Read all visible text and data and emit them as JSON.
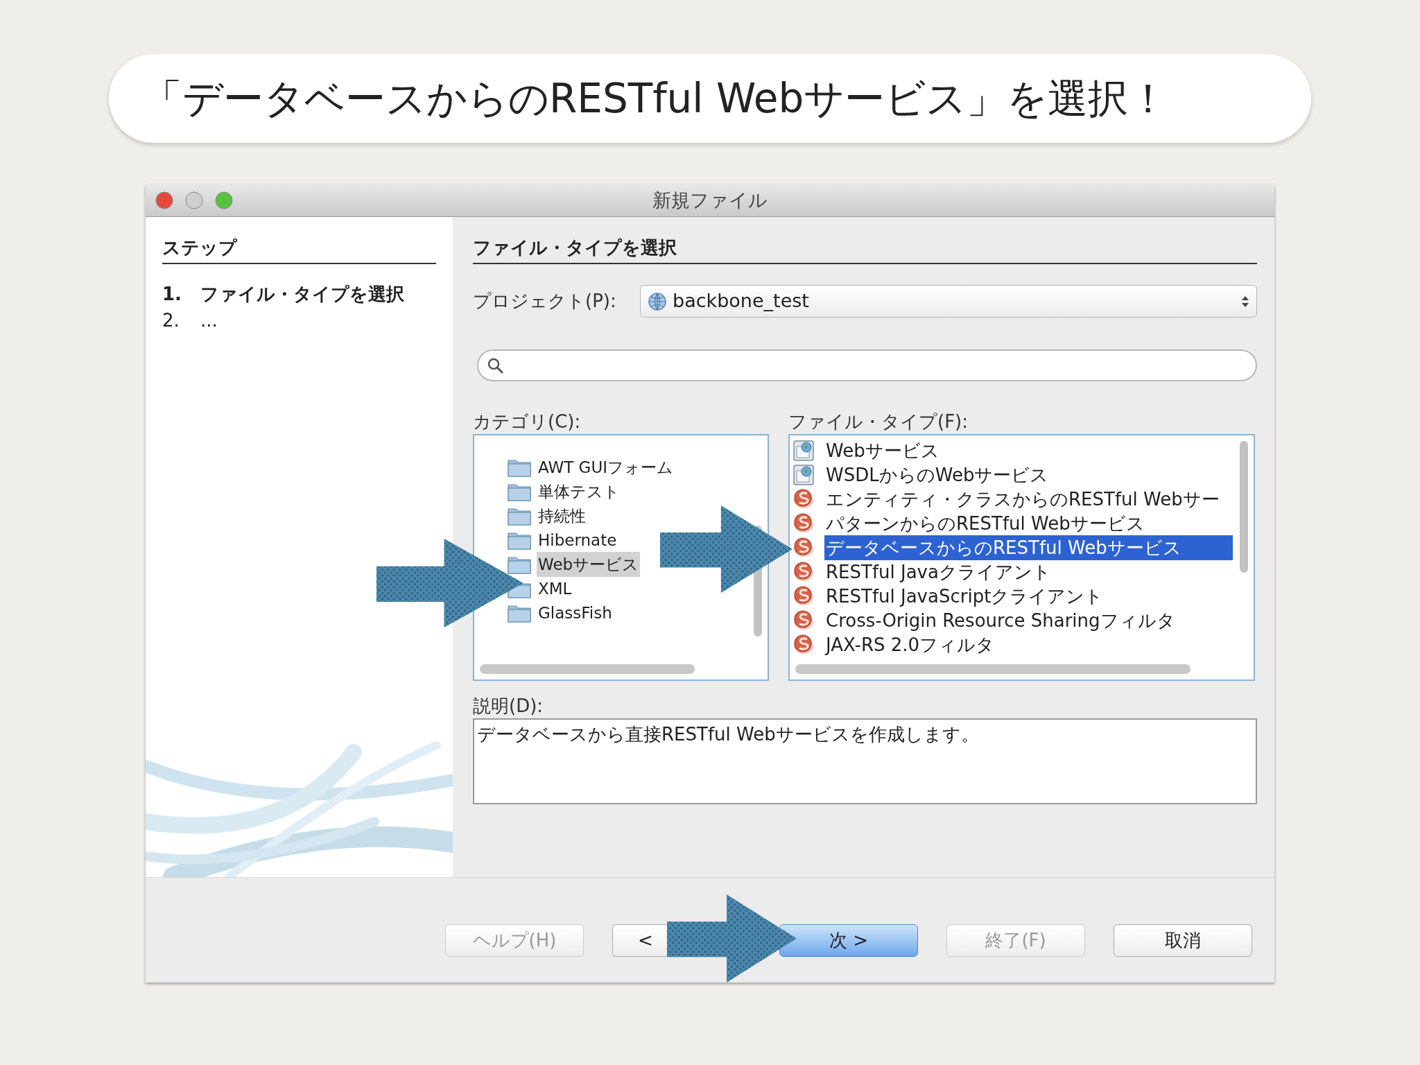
{
  "slide": {
    "caption": "「データベースからのRESTful Webサービス」を選択！"
  },
  "window": {
    "title": "新規ファイル"
  },
  "steps": {
    "title": "ステップ",
    "items": [
      {
        "number": "1.",
        "label": "ファイル・タイプを選択",
        "selected": true
      },
      {
        "number": "2.",
        "label": "...",
        "selected": false
      }
    ]
  },
  "panel": {
    "title": "ファイル・タイプを選択",
    "project_label": "プロジェクト(P):",
    "project": "backbone_test"
  },
  "categories": {
    "label": "カテゴリ(C):",
    "items": [
      {
        "label": "AWT GUIフォーム",
        "selected": false
      },
      {
        "label": "単体テスト",
        "selected": false
      },
      {
        "label": "持続性",
        "selected": false
      },
      {
        "label": "Hibernate",
        "selected": false
      },
      {
        "label": "Webサービス",
        "selected": true
      },
      {
        "label": "XML",
        "selected": false
      },
      {
        "label": "GlassFish",
        "selected": false
      }
    ]
  },
  "file_types": {
    "label": "ファイル・タイプ(F):",
    "items": [
      {
        "label": "Webサービス",
        "kind": "soap",
        "selected": false
      },
      {
        "label": "WSDLからのWebサービス",
        "kind": "soap",
        "selected": false
      },
      {
        "label": "エンティティ・クラスからのRESTful Webサー",
        "kind": "rest",
        "selected": false
      },
      {
        "label": "パターンからのRESTful Webサービス",
        "kind": "rest",
        "selected": false
      },
      {
        "label": "データベースからのRESTful Webサービス",
        "kind": "rest",
        "selected": true
      },
      {
        "label": "RESTful Javaクライアント",
        "kind": "rest",
        "selected": false
      },
      {
        "label": "RESTful JavaScriptクライアント",
        "kind": "rest",
        "selected": false
      },
      {
        "label": "Cross-Origin Resource Sharingフィルタ",
        "kind": "rest",
        "selected": false
      },
      {
        "label": "JAX-RS 2.0フィルタ",
        "kind": "rest",
        "selected": false
      }
    ]
  },
  "description": {
    "label": "説明(D):",
    "text": "データベースから直接RESTful Webサービスを作成します。"
  },
  "buttons": [
    {
      "label": "ヘルプ(H)",
      "disabled": true,
      "default": false
    },
    {
      "label": "<",
      "disabled": false,
      "default": false
    },
    {
      "label": "次 >",
      "disabled": false,
      "default": true
    },
    {
      "label": "終了(F)",
      "disabled": true,
      "default": false
    },
    {
      "label": "取消",
      "disabled": false,
      "default": false
    }
  ]
}
